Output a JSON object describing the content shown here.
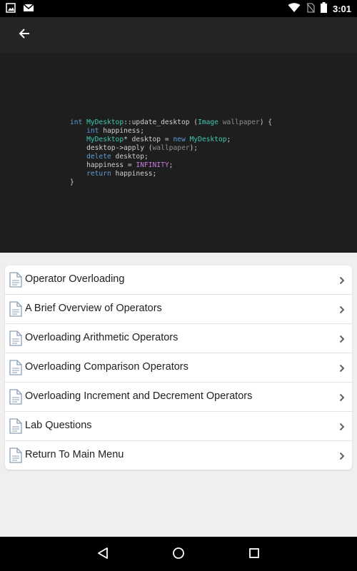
{
  "status_bar": {
    "time": "3:01",
    "left_icons": [
      "image-icon",
      "gmail-icon"
    ],
    "right_icons": [
      "wifi-icon",
      "no-sim-icon",
      "battery-icon"
    ]
  },
  "app_bar": {
    "back_icon": "arrow-back-icon"
  },
  "code": {
    "lines": [
      [
        {
          "t": "int ",
          "c": "kw"
        },
        {
          "t": "MyDesktop",
          "c": "ty"
        },
        {
          "t": "::update_desktop (",
          "c": "fn"
        },
        {
          "t": "Image",
          "c": "ty"
        },
        {
          "t": " wallpaper",
          "c": "pm"
        },
        {
          "t": ") {",
          "c": "fn"
        }
      ],
      [
        {
          "t": "    ",
          "c": "fn"
        },
        {
          "t": "int",
          "c": "kw"
        },
        {
          "t": " happiness;",
          "c": "fn"
        }
      ],
      [
        {
          "t": "    ",
          "c": "fn"
        },
        {
          "t": "MyDesktop",
          "c": "ty"
        },
        {
          "t": "* desktop = ",
          "c": "fn"
        },
        {
          "t": "new",
          "c": "kw"
        },
        {
          "t": " ",
          "c": "fn"
        },
        {
          "t": "MyDesktop",
          "c": "ty"
        },
        {
          "t": ";",
          "c": "fn"
        }
      ],
      [
        {
          "t": "    desktop->apply (",
          "c": "fn"
        },
        {
          "t": "wallpaper",
          "c": "pm"
        },
        {
          "t": ");",
          "c": "fn"
        }
      ],
      [
        {
          "t": "    ",
          "c": "fn"
        },
        {
          "t": "delete",
          "c": "kw"
        },
        {
          "t": " desktop;",
          "c": "fn"
        }
      ],
      [
        {
          "t": "    happiness = ",
          "c": "fn"
        },
        {
          "t": "INFINITY",
          "c": "cn"
        },
        {
          "t": ";",
          "c": "fn"
        }
      ],
      [
        {
          "t": "    ",
          "c": "fn"
        },
        {
          "t": "return",
          "c": "kw"
        },
        {
          "t": " happiness;",
          "c": "fn"
        }
      ],
      [
        {
          "t": "}",
          "c": "fn"
        }
      ]
    ]
  },
  "menu": {
    "items": [
      {
        "label": "Operator Overloading",
        "icon": "document-icon"
      },
      {
        "label": "A Brief Overview of Operators",
        "icon": "document-icon"
      },
      {
        "label": "Overloading Arithmetic Operators",
        "icon": "document-icon"
      },
      {
        "label": "Overloading Comparison Operators",
        "icon": "document-icon"
      },
      {
        "label": "Overloading Increment and Decrement Operators",
        "icon": "document-icon"
      },
      {
        "label": "Lab Questions",
        "icon": "document-icon"
      },
      {
        "label": "Return To Main Menu",
        "icon": "document-icon"
      }
    ]
  },
  "nav_bar": {
    "buttons": [
      "back-triangle-icon",
      "home-circle-icon",
      "recents-square-icon"
    ]
  },
  "colors": {
    "status_bar": "#000000",
    "app_bar": "#242424",
    "hero_bg": "#1e1e1e",
    "page_bg": "#efefef",
    "keyword": "#5b9bd5",
    "type": "#3ec7b0",
    "constant": "#c678dd"
  }
}
